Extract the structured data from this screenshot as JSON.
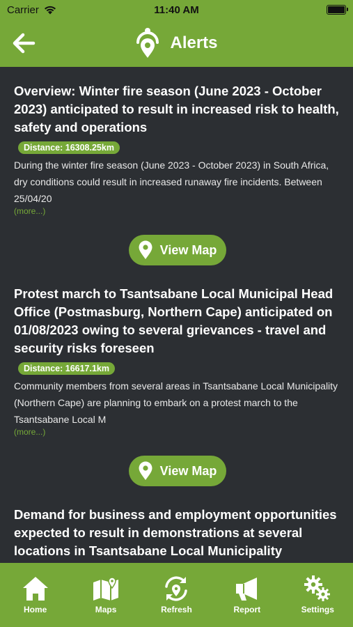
{
  "status_bar": {
    "carrier": "Carrier",
    "time": "11:40 AM"
  },
  "nav": {
    "title": "Alerts"
  },
  "alerts": [
    {
      "title": "Overview: Winter fire season (June 2023 - October 2023) anticipated to result in increased risk to health, safety and operations",
      "distance": "Distance: 16308.25km",
      "body": "During the winter fire season (June 2023 - October 2023) in South Africa, dry conditions could result in increased runaway fire incidents. Between 25/04/20",
      "more": "(more...)",
      "button": "View Map"
    },
    {
      "title": "Protest march to Tsantsabane Local Municipal Head Office (Postmasburg, Northern Cape) anticipated on 01/08/2023 owing to several grievances - travel and security risks foreseen",
      "distance": "Distance: 16617.1km",
      "body": "Community members from several areas in Tsantsabane Local Municipality (Northern Cape) are planning to embark on a protest march to the Tsantsabane Local M",
      "more": "(more...)",
      "button": "View Map"
    },
    {
      "title": "Demand for business and employment opportunities expected to result in demonstrations at several locations in Tsantsabane Local Municipality"
    }
  ],
  "tabs": [
    {
      "label": "Home",
      "icon": "home-icon"
    },
    {
      "label": "Maps",
      "icon": "map-icon"
    },
    {
      "label": "Refresh",
      "icon": "refresh-icon"
    },
    {
      "label": "Report",
      "icon": "megaphone-icon"
    },
    {
      "label": "Settings",
      "icon": "gears-icon"
    }
  ],
  "colors": {
    "accent": "#76a838",
    "background": "#2c2f33"
  }
}
